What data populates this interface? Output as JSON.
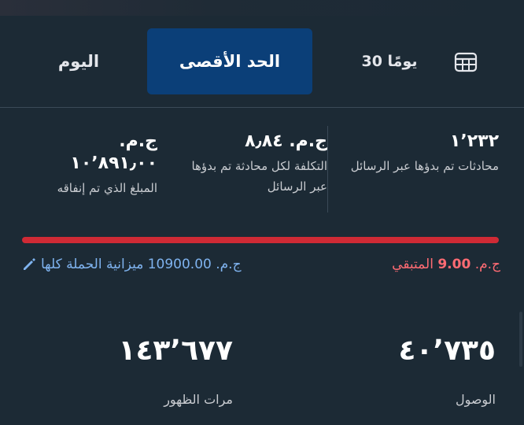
{
  "tabs": {
    "today": "اليوم",
    "max": "الحد الأقصى",
    "last30": "30 يومًا",
    "calendar_icon": "calendar-icon"
  },
  "stats": {
    "conversations": {
      "value": "١٬٢٣٢",
      "label": "محادثات تم بدؤها عبر الرسائل"
    },
    "cost_per_conv": {
      "value": "ج.م. ٨٫٨٤",
      "label": "التكلفة لكل محادثة تم بدؤها عبر الرسائل"
    },
    "spent": {
      "currency": "ج.م.",
      "value": "١٠٬٨٩١٫٠٠",
      "label": "المبلغ الذي تم إنفاقه"
    }
  },
  "budget": {
    "remaining_currency": "ج.م.",
    "remaining_amount": "9.00",
    "remaining_label": "المتبقي",
    "campaign_text": "ج.م. 10900.00 ميزانية الحملة كلها",
    "colors": {
      "bar": "#cf2a35",
      "remaining": "#ff6b73",
      "link": "#7fb3ef"
    },
    "spent_fraction": 0.999
  },
  "metrics": {
    "reach": {
      "value": "٤٠٬٧٣٥",
      "label": "الوصول"
    },
    "impressions": {
      "value": "١٤٣٬٦٧٧",
      "label": "مرات الظهور"
    }
  }
}
